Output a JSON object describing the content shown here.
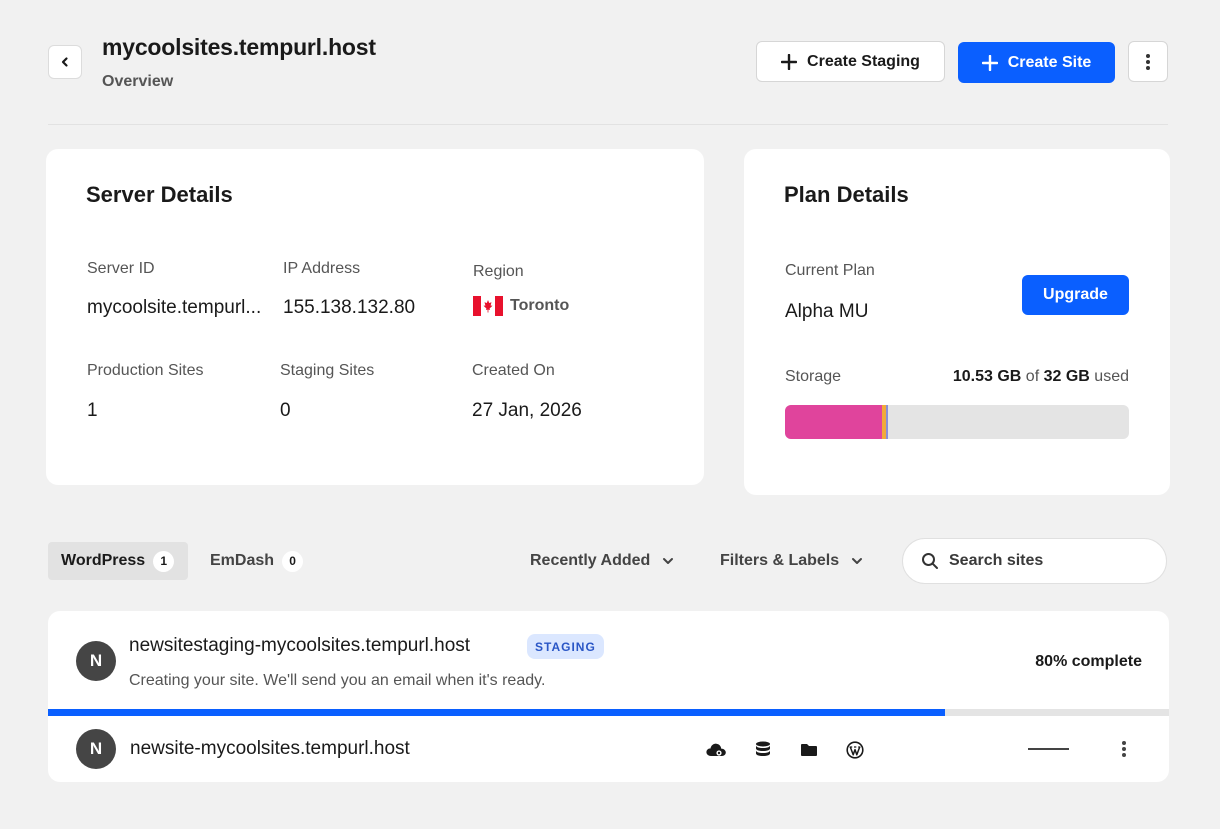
{
  "header": {
    "title": "mycoolsites.tempurl.host",
    "subtitle": "Overview",
    "create_staging_label": "Create Staging",
    "create_site_label": "Create Site"
  },
  "server": {
    "title": "Server Details",
    "server_id_label": "Server ID",
    "server_id": "mycoolsite.tempurl...",
    "ip_label": "IP Address",
    "ip": "155.138.132.80",
    "region_label": "Region",
    "region": "Toronto",
    "prod_label": "Production Sites",
    "prod_count": "1",
    "staging_label": "Staging Sites",
    "staging_count": "0",
    "created_label": "Created On",
    "created": "27 Jan, 2026"
  },
  "plan": {
    "title": "Plan Details",
    "current_label": "Current Plan",
    "current": "Alpha MU",
    "upgrade_label": "Upgrade",
    "storage_label": "Storage",
    "used": "10.53 GB",
    "of_text": "of",
    "total": "32 GB",
    "used_text": "used",
    "segments": [
      {
        "fraction": 0.282,
        "color": "#e0449c"
      },
      {
        "fraction": 0.012,
        "color": "#f2a93b"
      },
      {
        "fraction": 0.006,
        "color": "#8a8fd8"
      }
    ]
  },
  "tabs": [
    {
      "label": "WordPress",
      "count": "1",
      "active": true
    },
    {
      "label": "EmDash",
      "count": "0",
      "active": false
    }
  ],
  "sort": {
    "label": "Recently Added"
  },
  "filters": {
    "label": "Filters & Labels"
  },
  "search": {
    "placeholder": "Search sites"
  },
  "sites": [
    {
      "avatar": "N",
      "name": "newsitestaging-mycoolsites.tempurl.host",
      "badge": "STAGING",
      "description": "Creating your site. We'll send you an email when it's ready.",
      "status": "80% complete",
      "progress": 0.8
    },
    {
      "avatar": "N",
      "name": "newsite-mycoolsites.tempurl.host",
      "icons": [
        "cloud-settings-icon",
        "database-icon",
        "folder-icon",
        "wordpress-icon"
      ]
    }
  ],
  "colors": {
    "accent": "#0a5fff",
    "badge_bg": "#dbe7ff",
    "badge_text": "#2a56c6"
  }
}
